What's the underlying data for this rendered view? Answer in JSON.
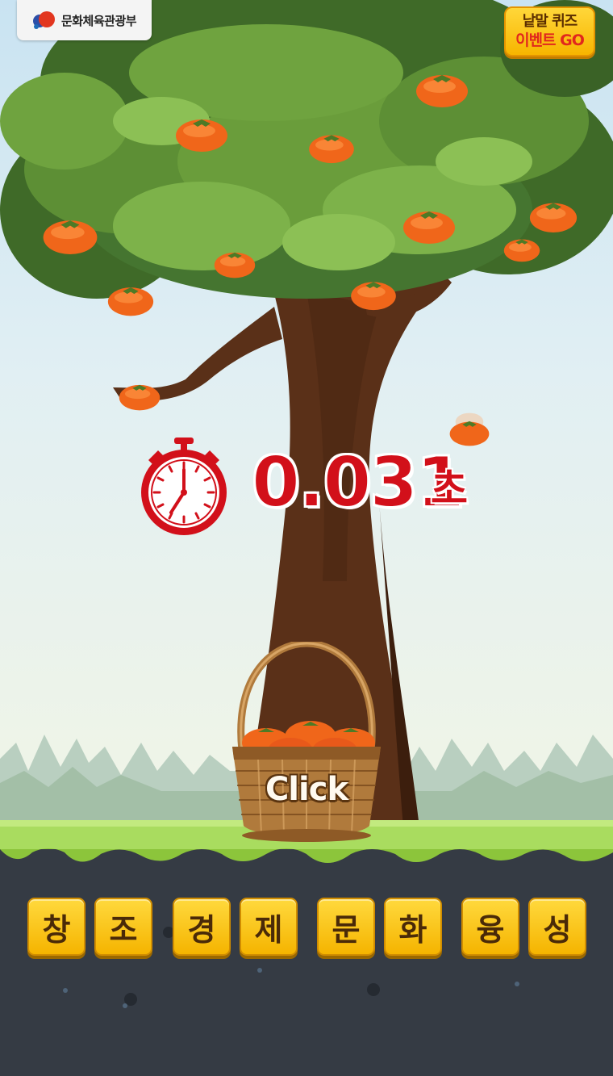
{
  "header": {
    "ministry_label": "문화체육관광부",
    "event_button": {
      "line1": "낱말 퀴즈",
      "line2": "이벤트 GO"
    }
  },
  "timer": {
    "value": "0.031",
    "unit": "초"
  },
  "basket": {
    "label": "Click"
  },
  "tiles": [
    "창",
    "조",
    "경",
    "제",
    "문",
    "화",
    "융",
    "성"
  ],
  "colors": {
    "timer_red": "#d2101a",
    "tile_yellow": "#f5b400",
    "ground": "#353b44",
    "grass": "#a9dc5f"
  }
}
